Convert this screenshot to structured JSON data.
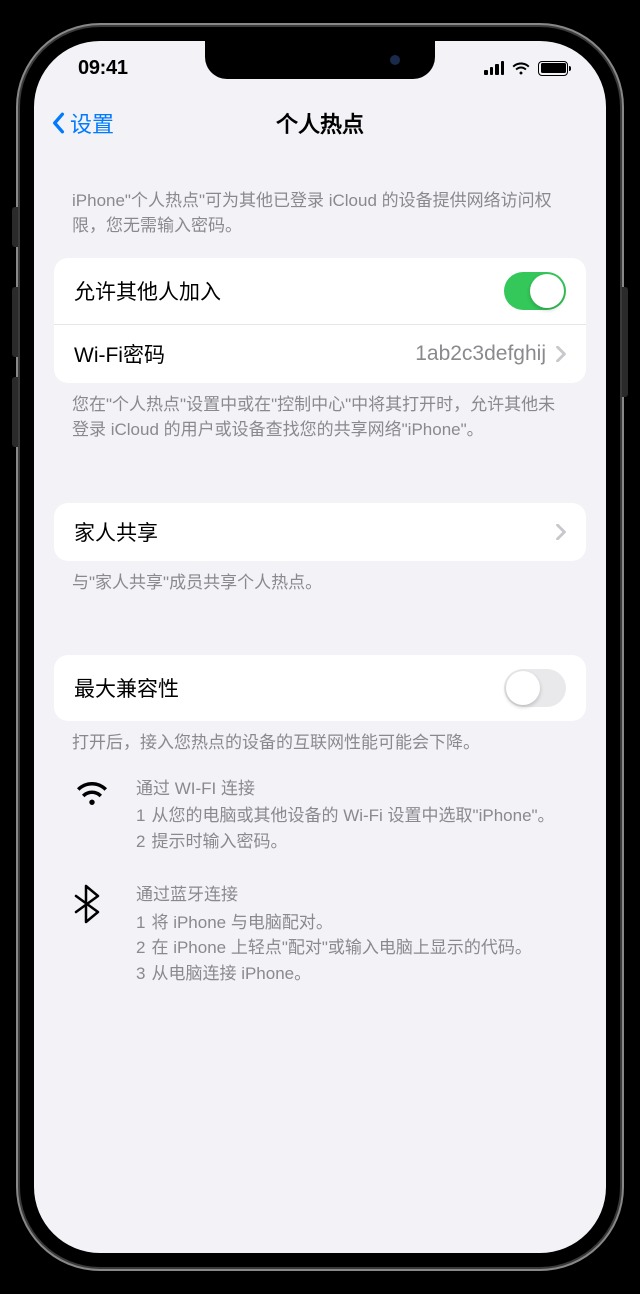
{
  "status": {
    "time": "09:41"
  },
  "nav": {
    "back_label": "设置",
    "title": "个人热点"
  },
  "header_description": "iPhone\"个人热点\"可为其他已登录 iCloud 的设备提供网络访问权限，您无需输入密码。",
  "allow_others": {
    "label": "允许其他人加入",
    "enabled": true
  },
  "wifi_password": {
    "label": "Wi-Fi密码",
    "value": "1ab2c3defghij"
  },
  "allow_footer": "您在\"个人热点\"设置中或在\"控制中心\"中将其打开时，允许其他未登录 iCloud 的用户或设备查找您的共享网络\"iPhone\"。",
  "family_sharing": {
    "label": "家人共享",
    "footer": "与\"家人共享\"成员共享个人热点。"
  },
  "max_compat": {
    "label": "最大兼容性",
    "enabled": false,
    "footer": "打开后，接入您热点的设备的互联网性能可能会下降。"
  },
  "instructions": {
    "wifi": {
      "title": "通过 WI-FI 连接",
      "steps": [
        "从您的电脑或其他设备的 Wi-Fi 设置中选取\"iPhone\"。",
        "提示时输入密码。"
      ]
    },
    "bluetooth": {
      "title": "通过蓝牙连接",
      "steps": [
        "将 iPhone 与电脑配对。",
        "在 iPhone 上轻点\"配对\"或输入电脑上显示的代码。",
        "从电脑连接 iPhone。"
      ]
    }
  }
}
